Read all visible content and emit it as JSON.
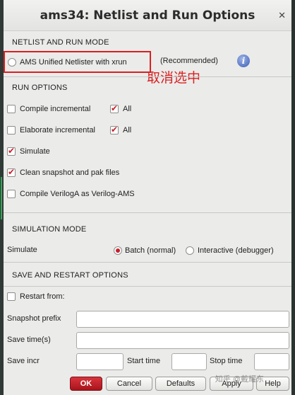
{
  "window": {
    "title": "ams34: Netlist and Run Options",
    "close_glyph": "✕"
  },
  "netlist": {
    "section_title": "NETLIST AND RUN MODE",
    "ams_unified_label": "AMS Unified Netlister with xrun",
    "ams_unified_selected": false,
    "recommended_text": "(Recommended)",
    "info_icon": "info-icon"
  },
  "annotation": {
    "text": "取消选中",
    "color": "#d92020"
  },
  "run_options": {
    "section_title": "RUN OPTIONS",
    "compile_incremental": {
      "label": "Compile incremental",
      "checked": false
    },
    "compile_all": {
      "label": "All",
      "checked": true
    },
    "elaborate_incremental": {
      "label": "Elaborate incremental",
      "checked": false
    },
    "elaborate_all": {
      "label": "All",
      "checked": true
    },
    "simulate": {
      "label": "Simulate",
      "checked": true
    },
    "clean_snapshot": {
      "label": "Clean snapshot and pak files",
      "checked": true
    },
    "compile_veriloga": {
      "label": "Compile VerilogA as Verilog-AMS",
      "checked": false
    }
  },
  "simulation_mode": {
    "section_title": "SIMULATION MODE",
    "simulate_label": "Simulate",
    "batch_label": "Batch (normal)",
    "batch_selected": true,
    "interactive_label": "Interactive (debugger)",
    "interactive_selected": false
  },
  "save_restart": {
    "section_title": "SAVE AND RESTART OPTIONS",
    "restart_from": {
      "label": "Restart from:",
      "checked": false
    },
    "snapshot_prefix_label": "Snapshot prefix",
    "snapshot_prefix_value": "",
    "save_times_label": "Save time(s)",
    "save_times_value": "",
    "save_incr_label": "Save incr",
    "save_incr_value": "",
    "start_time_label": "Start time",
    "start_time_value": "",
    "stop_time_label": "Stop time",
    "stop_time_value": ""
  },
  "buttons": {
    "ok_label": "OK",
    "cancel_label": "Cancel",
    "defaults_label": "Defaults",
    "apply_label": "Apply",
    "help_label": "Help"
  },
  "watermark": {
    "text": "知乎 @戴耀东"
  },
  "colors": {
    "accent_red": "#c8202a",
    "background": "#ebebea"
  }
}
